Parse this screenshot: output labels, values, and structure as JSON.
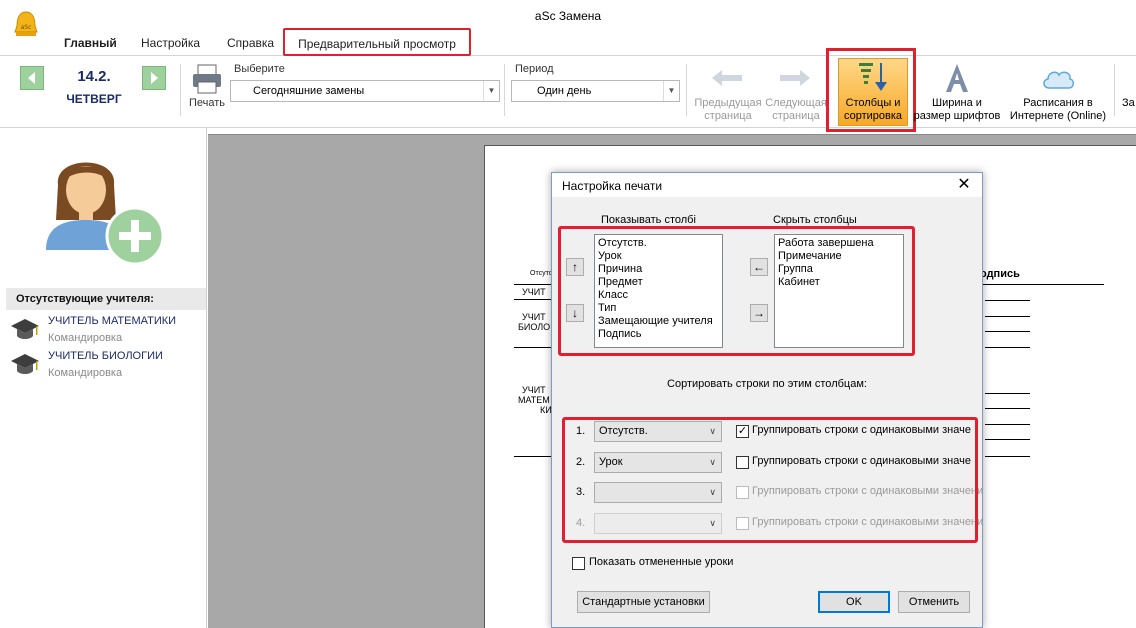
{
  "app": {
    "title": "aSc Замена"
  },
  "tabs": [
    {
      "label": "Главный"
    },
    {
      "label": "Настройка"
    },
    {
      "label": "Справка"
    },
    {
      "label": "Предварительный просмотр"
    }
  ],
  "ribbon": {
    "date": "14.2.",
    "weekday": "ЧЕТВЕРГ",
    "print_label": "Печать",
    "select_label": "Выберите",
    "select_value": "Сегодняшние замены",
    "period_label": "Период",
    "period_value": "Один день",
    "prev_page": [
      "Предыдущая",
      "страница"
    ],
    "next_page": [
      "Следующая",
      "страница"
    ],
    "columns_sort": [
      "Столбцы и",
      "сортировка"
    ],
    "font_width": [
      "Ширина и",
      "размер шрифтов"
    ],
    "online": [
      "Расписания в",
      "Интернете (Online)"
    ],
    "cut_label": "За"
  },
  "left_panel": {
    "absent_header": "Отсутствующие учителя:",
    "teachers": [
      {
        "name": "УЧИТЕЛЬ МАТЕМАТИКИ",
        "reason": "Командировка"
      },
      {
        "name": "УЧИТЕЛЬ БИОЛОГИИ",
        "reason": "Командировка"
      }
    ]
  },
  "paper": {
    "col_absent": "Отсутс",
    "col_sign": "одпись",
    "row1": "УЧИТ",
    "row2a": "УЧИТ",
    "row2b": "БИОЛО",
    "row3a": "УЧИТ",
    "row3b": "МАТЕМ",
    "row3c": "КИ"
  },
  "dialog": {
    "title": "Настройка печати",
    "show_columns_label": "Показывать столбі",
    "hide_columns_label": "Скрыть столбцы",
    "show_columns": [
      "Отсутств.",
      "Урок",
      "Причина",
      "Предмет",
      "Класс",
      "Тип",
      "Замещающие учителя",
      "Подпись"
    ],
    "hide_columns": [
      "Работа завершена",
      "Примечание",
      "Группа",
      "Кабинет"
    ],
    "sort_label": "Сортировать строки по этим столбцам:",
    "sort_rows": [
      {
        "num": "1.",
        "value": "Отсутств.",
        "checked": true,
        "enabled": true
      },
      {
        "num": "2.",
        "value": "Урок",
        "checked": false,
        "enabled": true
      },
      {
        "num": "3.",
        "value": "",
        "checked": false,
        "enabled": false
      },
      {
        "num": "4.",
        "value": "",
        "checked": false,
        "enabled": false
      }
    ],
    "group_label": "Группировать строки с одинаковыми значе",
    "group_label_long": "Группировать строки с одинаковыми значени",
    "show_cancelled": "Показать отмененные уроки",
    "defaults_button": "Стандартные установки",
    "ok_button": "OK",
    "cancel_button": "Отменить"
  }
}
